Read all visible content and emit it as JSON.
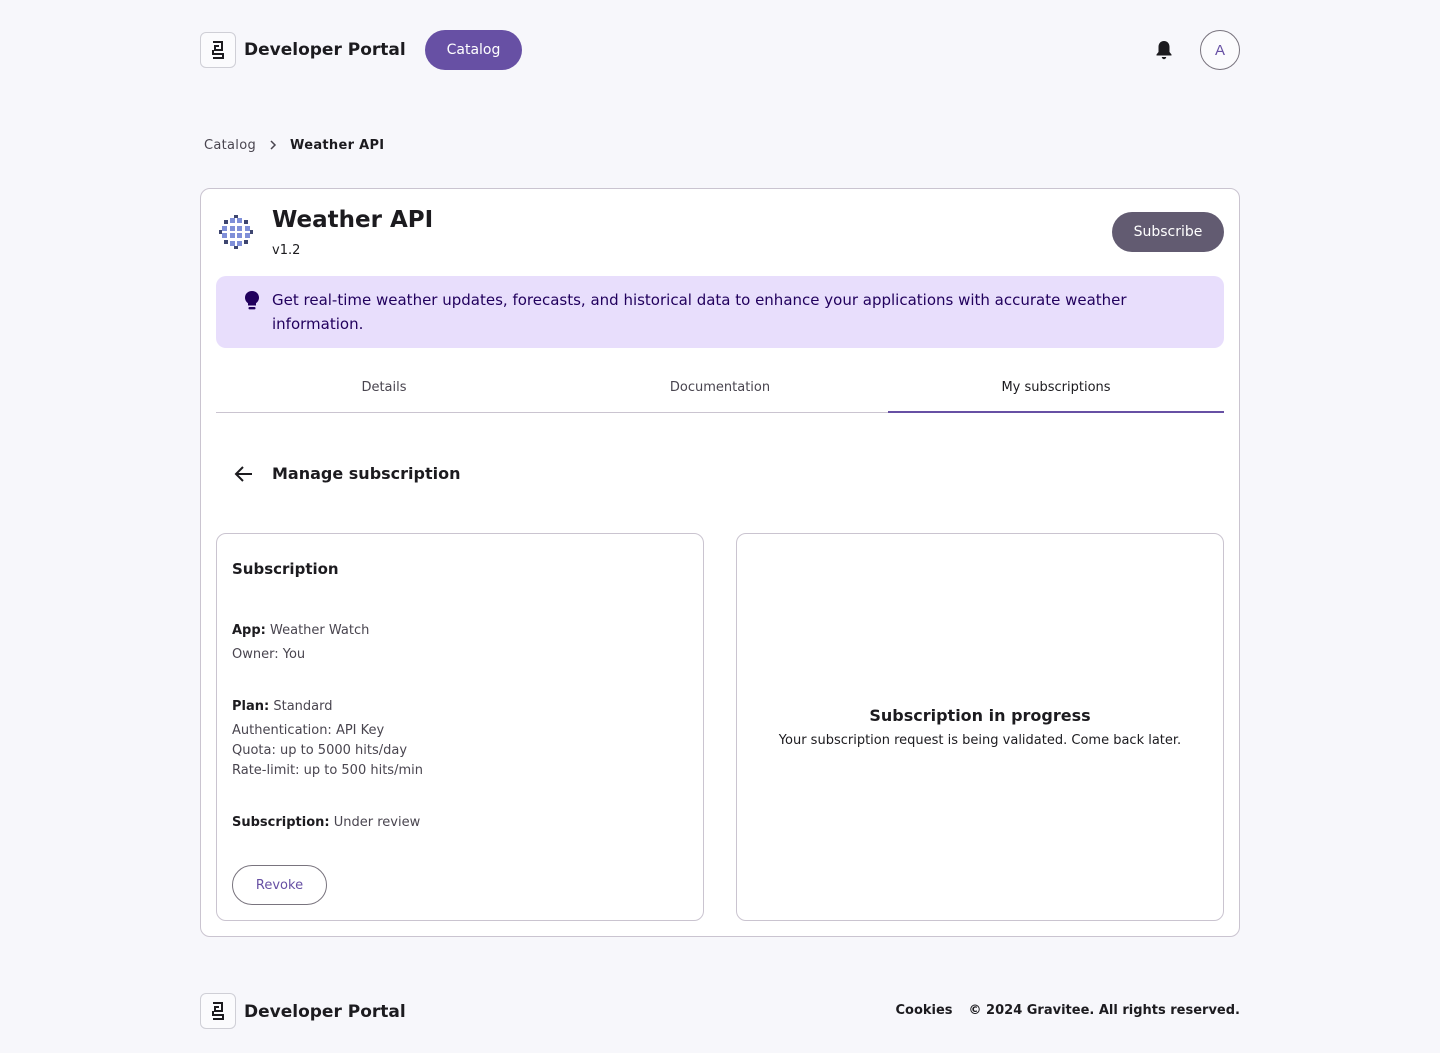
{
  "header": {
    "brand": "Developer Portal",
    "nav_catalog": "Catalog",
    "avatar_initial": "A"
  },
  "breadcrumb": {
    "parent": "Catalog",
    "current": "Weather API"
  },
  "api": {
    "title": "Weather API",
    "version": "v1.2",
    "subscribe_label": "Subscribe",
    "description": "Get real-time weather updates, forecasts, and historical data to enhance your applications with accurate weather information."
  },
  "tabs": [
    {
      "label": "Details",
      "active": false
    },
    {
      "label": "Documentation",
      "active": false
    },
    {
      "label": "My subscriptions",
      "active": true
    }
  ],
  "manage": {
    "title": "Manage subscription"
  },
  "subscription": {
    "heading": "Subscription",
    "app_label": "App:",
    "app_value": "Weather Watch",
    "owner": "Owner: You",
    "plan_label": "Plan:",
    "plan_value": "Standard",
    "authentication": "Authentication: API Key",
    "quota": "Quota: up to 5000 hits/day",
    "rate_limit": "Rate-limit: up to 500 hits/min",
    "status_label": "Subscription:",
    "status_value": "Under review",
    "revoke_label": "Revoke"
  },
  "progress": {
    "title": "Subscription in progress",
    "message": "Your subscription request is being validated. Come back later."
  },
  "footer": {
    "brand": "Developer Portal",
    "cookies": "Cookies",
    "copyright": "© 2024 Gravitee. All rights reserved."
  },
  "colors": {
    "primary": "#6750a4",
    "subscribe_button": "#625b71",
    "banner_bg": "#e8defc",
    "banner_text": "#21005d"
  },
  "icons": {
    "logo": "gravitee-g-icon",
    "notifications": "bell-icon",
    "breadcrumb_separator": "chevron-right-icon",
    "api": "api-pattern-icon",
    "banner": "lightbulb-icon",
    "back": "arrow-back-icon"
  }
}
